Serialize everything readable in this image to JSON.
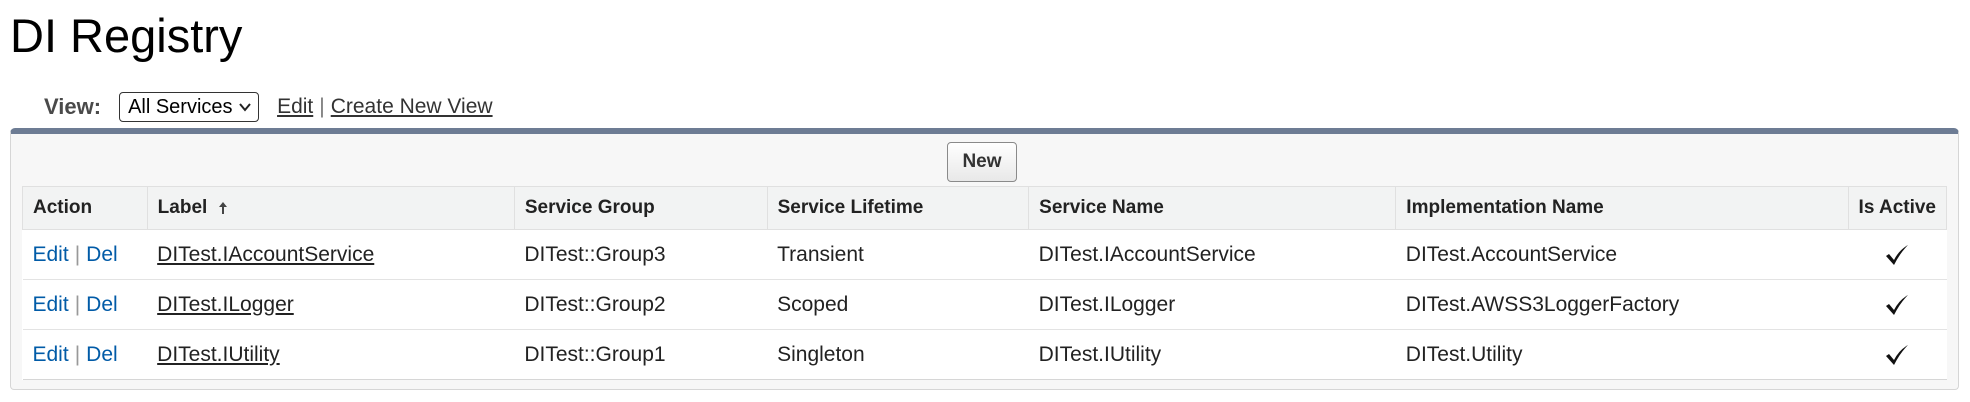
{
  "page": {
    "title": "DI Registry"
  },
  "view_bar": {
    "label": "View:",
    "selected_view": "All Services",
    "edit_link": "Edit",
    "separator": "|",
    "create_link": "Create New View"
  },
  "toolbar": {
    "new_label": "New"
  },
  "table": {
    "headers": {
      "action": "Action",
      "label": "Label",
      "service_group": "Service Group",
      "service_lifetime": "Service Lifetime",
      "service_name": "Service Name",
      "implementation_name": "Implementation Name",
      "is_active": "Is Active"
    },
    "sort_icon": "arrow-up-icon",
    "action_labels": {
      "edit": "Edit",
      "separator": "|",
      "del": "Del"
    },
    "rows": [
      {
        "label": "DITest.IAccountService",
        "service_group": "DITest::Group3",
        "service_lifetime": "Transient",
        "service_name": "DITest.IAccountService",
        "implementation_name": "DITest.AccountService",
        "is_active": true
      },
      {
        "label": "DITest.ILogger",
        "service_group": "DITest::Group2",
        "service_lifetime": "Scoped",
        "service_name": "DITest.ILogger",
        "implementation_name": "DITest.AWSS3LoggerFactory",
        "is_active": true
      },
      {
        "label": "DITest.IUtility",
        "service_group": "DITest::Group1",
        "service_lifetime": "Singleton",
        "service_name": "DITest.IUtility",
        "implementation_name": "DITest.Utility",
        "is_active": true
      }
    ]
  },
  "colors": {
    "panel_top_border": "#6d7c94",
    "action_link": "#015ba7",
    "header_bg": "#f2f3f3"
  }
}
